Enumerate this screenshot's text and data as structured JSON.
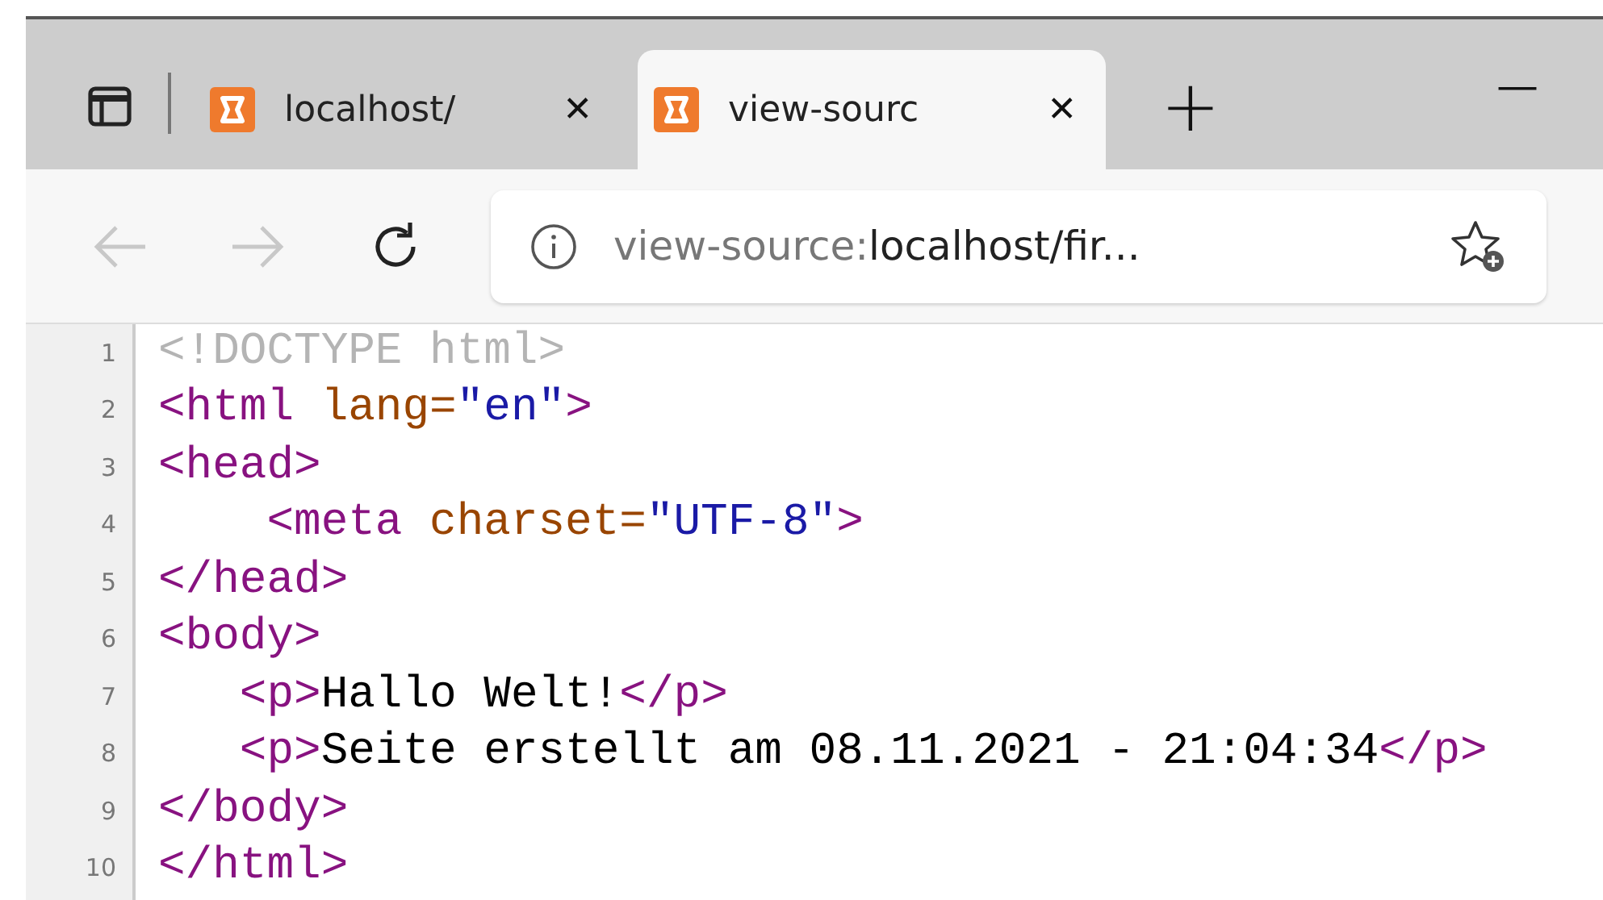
{
  "tabs": [
    {
      "title": "localhost/",
      "close": "✕",
      "selected": false
    },
    {
      "title": "view-sourc",
      "close": "✕",
      "selected": true
    }
  ],
  "new_tab": "+",
  "minimize": "—",
  "toolbar": {
    "back_disabled": true,
    "forward_disabled": true
  },
  "address_bar": {
    "scheme": "view-source:",
    "rest": "localhost/fir..."
  },
  "source_lines": [
    {
      "number": "1",
      "tokens": [
        {
          "kind": "doctype",
          "text": "<!DOCTYPE html>"
        }
      ]
    },
    {
      "number": "2",
      "tokens": [
        {
          "kind": "tag",
          "text": "<html "
        },
        {
          "kind": "attr",
          "text": "lang="
        },
        {
          "kind": "value",
          "text": "\"en\""
        },
        {
          "kind": "tag",
          "text": ">"
        }
      ]
    },
    {
      "number": "3",
      "tokens": [
        {
          "kind": "tag",
          "text": "<head>"
        }
      ]
    },
    {
      "number": "4",
      "tokens": [
        {
          "kind": "tag",
          "text": "    <meta "
        },
        {
          "kind": "attr",
          "text": "charset="
        },
        {
          "kind": "value",
          "text": "\"UTF-8\""
        },
        {
          "kind": "tag",
          "text": ">"
        }
      ]
    },
    {
      "number": "5",
      "tokens": [
        {
          "kind": "tag",
          "text": "</head>"
        }
      ]
    },
    {
      "number": "6",
      "tokens": [
        {
          "kind": "tag",
          "text": "<body>"
        }
      ]
    },
    {
      "number": "7",
      "tokens": [
        {
          "kind": "tag",
          "text": "   <p>"
        },
        {
          "kind": "text",
          "text": "Hallo Welt!"
        },
        {
          "kind": "tag",
          "text": "</p>"
        }
      ]
    },
    {
      "number": "8",
      "tokens": [
        {
          "kind": "tag",
          "text": "   <p>"
        },
        {
          "kind": "text",
          "text": "Seite erstellt am 08.11.2021 - 21:04:34"
        },
        {
          "kind": "tag",
          "text": "</p>"
        }
      ]
    },
    {
      "number": "9",
      "tokens": [
        {
          "kind": "tag",
          "text": "</body>"
        }
      ]
    },
    {
      "number": "10",
      "tokens": [
        {
          "kind": "tag",
          "text": "</html>"
        }
      ]
    }
  ]
}
